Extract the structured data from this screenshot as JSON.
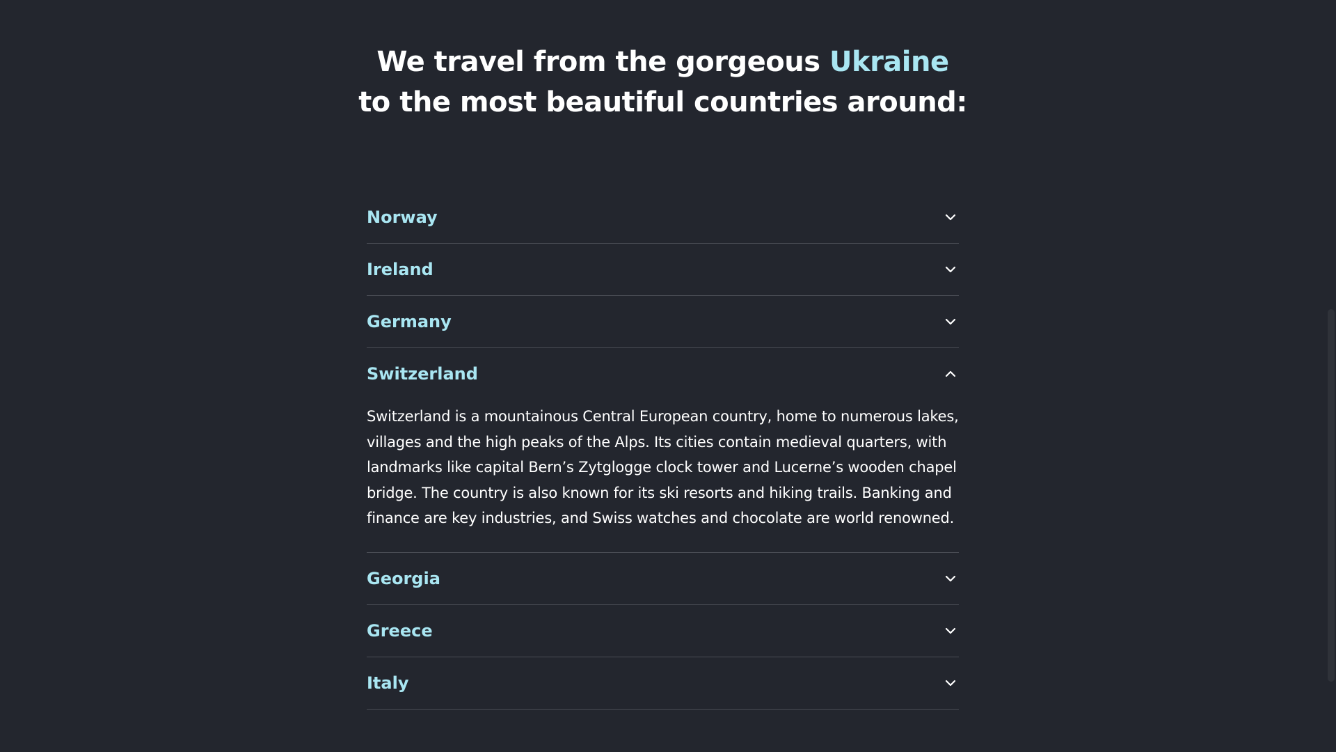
{
  "heading": {
    "line1_prefix": "We travel from the gorgeous",
    "line1_accent": "Ukraine",
    "line2": "to the most beautiful countries around:"
  },
  "accordion": {
    "items": [
      {
        "title": "Norway",
        "expanded": false
      },
      {
        "title": "Ireland",
        "expanded": false
      },
      {
        "title": "Germany",
        "expanded": false
      },
      {
        "title": "Switzerland",
        "expanded": true,
        "body": "Switzerland is a mountainous Central European country, home to numerous lakes, villages and the high peaks of the Alps. Its cities contain medieval quarters, with landmarks like capital Bern’s Zytglogge clock tower and Lucerne’s wooden chapel bridge. The country is also known for its ski resorts and hiking trails. Banking and finance are key industries, and Swiss watches and chocolate are world renowned."
      },
      {
        "title": "Georgia",
        "expanded": false
      },
      {
        "title": "Greece",
        "expanded": false
      },
      {
        "title": "Italy",
        "expanded": false
      }
    ]
  },
  "colors": {
    "background": "#23262e",
    "accent": "#a9e6f2",
    "text": "#ffffff",
    "divider": "#4a4d55"
  },
  "icons": {
    "collapsed": "chevron-down-icon",
    "expanded": "chevron-up-icon"
  }
}
